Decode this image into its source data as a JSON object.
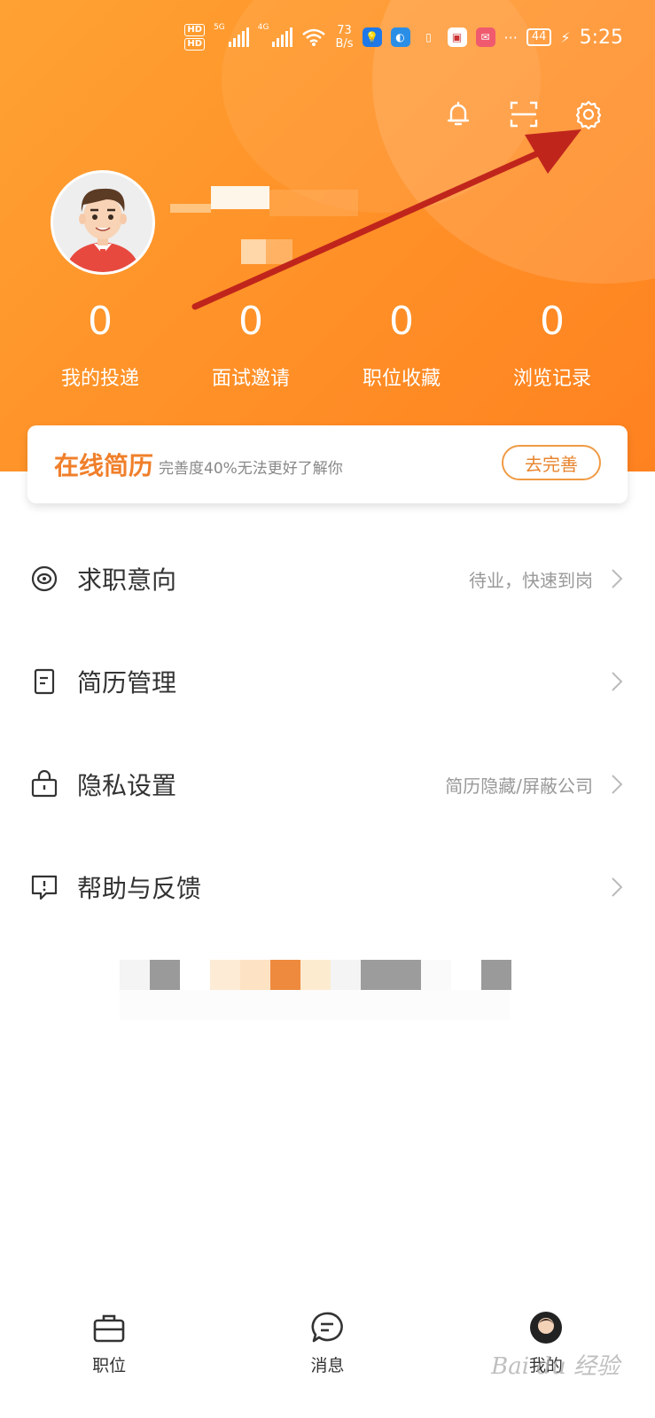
{
  "status_bar": {
    "network_left": "5G",
    "network_right": "4G",
    "speed_value": "73",
    "speed_unit": "B/s",
    "more": "···",
    "battery": "44",
    "time": "5:25"
  },
  "header": {
    "icons": [
      "bell-icon",
      "scan-icon",
      "settings-icon"
    ],
    "stats": [
      {
        "value": "0",
        "label": "我的投递"
      },
      {
        "value": "0",
        "label": "面试邀请"
      },
      {
        "value": "0",
        "label": "职位收藏"
      },
      {
        "value": "0",
        "label": "浏览记录"
      }
    ]
  },
  "resume_card": {
    "title": "在线简历",
    "subtitle": "完善度40%无法更好了解你",
    "button": "去完善"
  },
  "menu": [
    {
      "icon": "target-icon",
      "label": "求职意向",
      "value": "待业，快速到岗"
    },
    {
      "icon": "document-icon",
      "label": "简历管理",
      "value": ""
    },
    {
      "icon": "lock-icon",
      "label": "隐私设置",
      "value": "简历隐藏/屏蔽公司"
    },
    {
      "icon": "feedback-icon",
      "label": "帮助与反馈",
      "value": ""
    }
  ],
  "bottom_nav": [
    {
      "icon": "briefcase-icon",
      "label": "职位"
    },
    {
      "icon": "chat-icon",
      "label": "消息"
    },
    {
      "icon": "profile-icon",
      "label": "我的"
    }
  ],
  "watermark": "Bai du 经验",
  "colors": {
    "header_orange": "#ff9329",
    "accent_orange": "#f07f2a",
    "arrow_red": "#c0251c"
  }
}
